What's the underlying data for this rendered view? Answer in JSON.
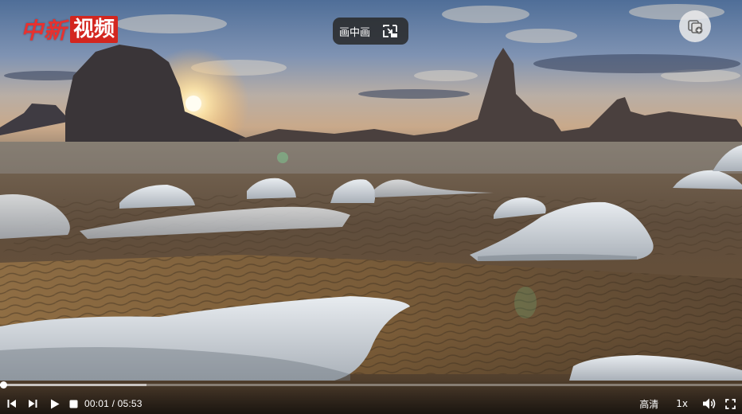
{
  "watermark": {
    "logo_part_red": "中新",
    "logo_part_box": "视频"
  },
  "overlay": {
    "pip_label": "画中画",
    "pip_icon": "pip-exit-icon",
    "top_right_icon": "screenshot-icon"
  },
  "controls": {
    "current_time": "00:01",
    "separator": " / ",
    "duration": "05:53",
    "quality_label": "高清",
    "speed_label": "1x",
    "played_fraction": 0.003,
    "buffered_fraction": 0.197,
    "icons": [
      "skip-previous-icon",
      "skip-next-icon",
      "play-icon",
      "stop-icon",
      "volume-icon",
      "fullscreen-icon"
    ]
  },
  "colors": {
    "logo_red": "#e8312f",
    "logo_box": "#d3261f",
    "progress_played": "#ffffff"
  }
}
